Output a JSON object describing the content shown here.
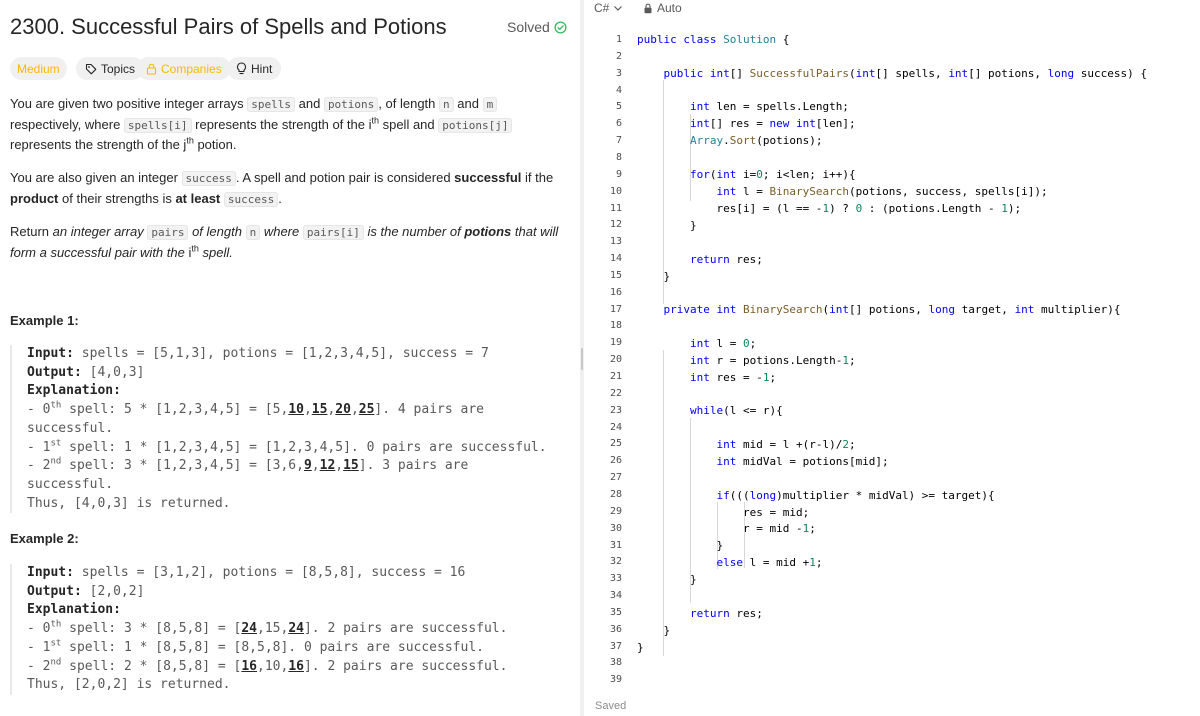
{
  "problem": {
    "title": "2300. Successful Pairs of Spells and Potions",
    "solved_label": "Solved",
    "tags": {
      "difficulty": "Medium",
      "topics": "Topics",
      "companies": "Companies",
      "hint": "Hint"
    },
    "colors": {
      "medium": "#ffb800",
      "solved_check": "#2cbb5d"
    }
  },
  "example1": {
    "title": "Example 1:",
    "input": "spells = [5,1,3], potions = [1,2,3,4,5], success = 7",
    "output": "[4,0,3]",
    "result": "Thus, [4,0,3] is returned."
  },
  "example2": {
    "title": "Example 2:",
    "input": "spells = [3,1,2], potions = [8,5,8], success = 16",
    "output": "[2,0,2]",
    "result": "Thus, [2,0,2] is returned."
  },
  "labels": {
    "input": "Input:",
    "output": "Output:",
    "explanation": "Explanation:"
  },
  "editor": {
    "language": "C#",
    "mode": "Auto",
    "status": "Saved",
    "line_count": 39
  }
}
